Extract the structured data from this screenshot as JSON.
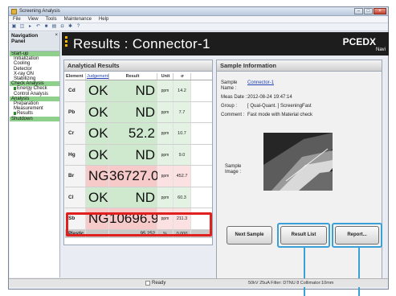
{
  "window": {
    "title": "Screening Analysis"
  },
  "menu": [
    "File",
    "View",
    "Tools",
    "Maintenance",
    "Help"
  ],
  "toolbar_icons": [
    "new-icon",
    "open-icon",
    "play-icon",
    "undo-icon",
    "stop-icon",
    "save-icon",
    "print-icon",
    "settings-icon",
    "help-icon"
  ],
  "nav": {
    "title_line1": "Navigation",
    "title_line2": "Panel",
    "close": "×",
    "items": [
      {
        "label": "Start-up",
        "level": 0,
        "green": true
      },
      {
        "label": "Initialization",
        "level": 1
      },
      {
        "label": "Cooling",
        "level": 1
      },
      {
        "label": "Detector",
        "level": 1
      },
      {
        "label": "X-ray ON",
        "level": 1
      },
      {
        "label": "Stabilizing",
        "level": 1
      },
      {
        "label": "Check Analysis",
        "level": 0,
        "green": true
      },
      {
        "label": "Energy Check",
        "level": 1,
        "marker": true
      },
      {
        "label": "Control Analysis",
        "level": 1
      },
      {
        "label": "Analysis",
        "level": 0,
        "green": true
      },
      {
        "label": "Preparation",
        "level": 1
      },
      {
        "label": "Measurement",
        "level": 1
      },
      {
        "label": "Results",
        "level": 1,
        "marker": true
      },
      {
        "label": "Shutdown",
        "level": 0,
        "green": true
      }
    ]
  },
  "header": {
    "title": "Results : Connector-1",
    "logo_main": "PCEDX",
    "logo_sub": "Navi"
  },
  "results": {
    "panel_title": "Analytical Results",
    "columns": [
      "Element",
      "Judgement",
      "Result",
      "Unit",
      "σ"
    ],
    "rows": [
      {
        "element": "Cd",
        "judgement": "OK",
        "result": "ND",
        "unit": "ppm",
        "sigma": "14.2",
        "status": "ok"
      },
      {
        "element": "Pb",
        "judgement": "OK",
        "result": "ND",
        "unit": "ppm",
        "sigma": "7.7",
        "status": "ok"
      },
      {
        "element": "Cr",
        "judgement": "OK",
        "result": "52.2",
        "unit": "ppm",
        "sigma": "10.7",
        "status": "ok"
      },
      {
        "element": "Hg",
        "judgement": "OK",
        "result": "ND",
        "unit": "ppm",
        "sigma": "9.0",
        "status": "ok"
      },
      {
        "element": "Br",
        "judgement": "NG",
        "result": "36727.0",
        "unit": "ppm",
        "sigma": "452.7",
        "status": "ng"
      },
      {
        "element": "Cl",
        "judgement": "OK",
        "result": "ND",
        "unit": "ppm",
        "sigma": "60.3",
        "status": "ok"
      },
      {
        "element": "Sb",
        "judgement": "NG",
        "result": "10696.9",
        "unit": "ppm",
        "sigma": "211.3",
        "status": "ng"
      }
    ],
    "plastic": {
      "element": "Plastic",
      "judgement": "",
      "result": "95.252",
      "unit": "%",
      "sigma": "0.000"
    }
  },
  "sample": {
    "panel_title": "Sample Information",
    "name_label": "Sample Name :",
    "name_value": "Connector-1",
    "date_label": "Meas Date :",
    "date_value": "2012-08-24 19:47:14",
    "group_label": "Group :",
    "group_value": "[ Qual-Quant. ] ScreeningFast",
    "comment_label": "Comment :",
    "comment_value": "Fast mode with Material check",
    "image_label": "Sample Image :"
  },
  "buttons": {
    "next_sample": "Next Sample",
    "result_list": "Result List",
    "report": "Report..."
  },
  "status": {
    "ready": "Ready",
    "conditions": "50kV 25uA Filter: DTNU 8 Collimator:10mm"
  },
  "colors": {
    "ok_bg": "#cfe9cf",
    "ng_bg": "#f7caca",
    "highlight": "#e0201e",
    "callout": "#3aa0d6",
    "header_bg": "#1d1d1d",
    "accent": "#f4b400"
  }
}
